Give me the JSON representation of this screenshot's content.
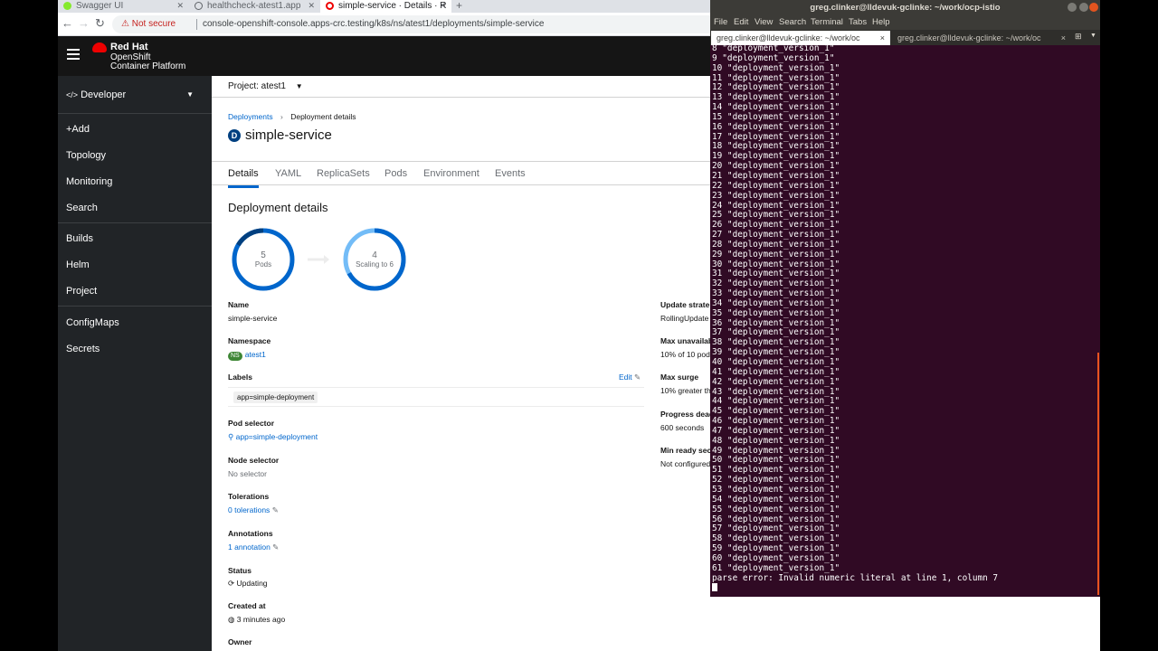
{
  "browser": {
    "tabs": [
      {
        "title": "Swagger UI",
        "fav_color": "#85ea2d"
      },
      {
        "title": "healthcheck-atest1.app",
        "fav_color": "#5f6368"
      },
      {
        "title": "simple-service · Details · R",
        "fav_color": "#ee0000"
      }
    ],
    "new_tab": "+",
    "not_secure": "Not secure",
    "url": "console-openshift-console.apps-crc.testing/k8s/ns/atest1/deployments/simple-service"
  },
  "masthead": {
    "brand_line1": "Red Hat",
    "brand_line2": "OpenShift",
    "brand_line3": "Container Platform"
  },
  "sidebar": {
    "perspective": "Developer",
    "items": [
      "+Add",
      "Topology",
      "Monitoring",
      "Search",
      "Builds",
      "Helm",
      "Project",
      "ConfigMaps",
      "Secrets"
    ]
  },
  "main": {
    "project_label": "Project: atest1",
    "breadcrumb_root": "Deployments",
    "breadcrumb_current": "Deployment details",
    "badge": "D",
    "title": "simple-service",
    "tabs": [
      "Details",
      "YAML",
      "ReplicaSets",
      "Pods",
      "Environment",
      "Events"
    ],
    "section_title": "Deployment details",
    "donut1": {
      "value": "5",
      "label": "Pods",
      "fill": 1.0
    },
    "donut2": {
      "value": "4",
      "label": "Scaling to 6",
      "fill": 0.67
    },
    "fields": {
      "name_label": "Name",
      "name_value": "simple-service",
      "namespace_label": "Namespace",
      "namespace_badge": "NS",
      "namespace_value": "atest1",
      "labels_label": "Labels",
      "labels_edit": "Edit",
      "labels_chip": "app=simple-deployment",
      "pod_selector_label": "Pod selector",
      "pod_selector_value": "app=simple-deployment",
      "node_selector_label": "Node selector",
      "node_selector_value": "No selector",
      "tolerations_label": "Tolerations",
      "tolerations_value": "0 tolerations",
      "annotations_label": "Annotations",
      "annotations_value": "1 annotation",
      "status_label": "Status",
      "status_value": "Updating",
      "created_label": "Created at",
      "created_value": "3 minutes ago",
      "owner_label": "Owner"
    },
    "right_fields": {
      "update_strategy_label": "Update strate",
      "update_strategy_value": "RollingUpdate",
      "max_unavailable_label": "Max unavailab",
      "max_unavailable_value": "10% of 10 pods",
      "max_surge_label": "Max surge",
      "max_surge_value": "10% greater th",
      "progress_label": "Progress dead",
      "progress_value": "600 seconds",
      "min_ready_label": "Min ready sec",
      "min_ready_value": "Not configured"
    }
  },
  "terminal": {
    "title": "greg.clinker@lldevuk-gclinke: ~/work/ocp-istio",
    "menu": [
      "File",
      "Edit",
      "View",
      "Search",
      "Terminal",
      "Tabs",
      "Help"
    ],
    "tabs": [
      "greg.clinker@lldevuk-gclinke: ~/work/oc",
      "greg.clinker@lldevuk-gclinke: ~/work/oc"
    ],
    "lines": [
      "8 \"deployment_version_1\"",
      "9 \"deployment_version_1\"",
      "10 \"deployment_version_1\"",
      "11 \"deployment_version_1\"",
      "12 \"deployment_version_1\"",
      "13 \"deployment_version_1\"",
      "14 \"deployment_version_1\"",
      "15 \"deployment_version_1\"",
      "16 \"deployment_version_1\"",
      "17 \"deployment_version_1\"",
      "18 \"deployment_version_1\"",
      "19 \"deployment_version_1\"",
      "20 \"deployment_version_1\"",
      "21 \"deployment_version_1\"",
      "22 \"deployment_version_1\"",
      "23 \"deployment_version_1\"",
      "24 \"deployment_version_1\"",
      "25 \"deployment_version_1\"",
      "26 \"deployment_version_1\"",
      "27 \"deployment_version_1\"",
      "28 \"deployment_version_1\"",
      "29 \"deployment_version_1\"",
      "30 \"deployment_version_1\"",
      "31 \"deployment_version_1\"",
      "32 \"deployment_version_1\"",
      "33 \"deployment_version_1\"",
      "34 \"deployment_version_1\"",
      "35 \"deployment_version_1\"",
      "36 \"deployment_version_1\"",
      "37 \"deployment_version_1\"",
      "38 \"deployment_version_1\"",
      "39 \"deployment_version_1\"",
      "40 \"deployment_version_1\"",
      "41 \"deployment_version_1\"",
      "42 \"deployment_version_1\"",
      "43 \"deployment_version_1\"",
      "44 \"deployment_version_1\"",
      "45 \"deployment_version_1\"",
      "46 \"deployment_version_1\"",
      "47 \"deployment_version_1\"",
      "48 \"deployment_version_1\"",
      "49 \"deployment_version_1\"",
      "50 \"deployment_version_1\"",
      "51 \"deployment_version_1\"",
      "52 \"deployment_version_1\"",
      "53 \"deployment_version_1\"",
      "54 \"deployment_version_1\"",
      "55 \"deployment_version_1\"",
      "56 \"deployment_version_1\"",
      "57 \"deployment_version_1\"",
      "58 \"deployment_version_1\"",
      "59 \"deployment_version_1\"",
      "60 \"deployment_version_1\"",
      "61 \"deployment_version_1\"",
      "parse error: Invalid numeric literal at line 1, column 7"
    ]
  }
}
